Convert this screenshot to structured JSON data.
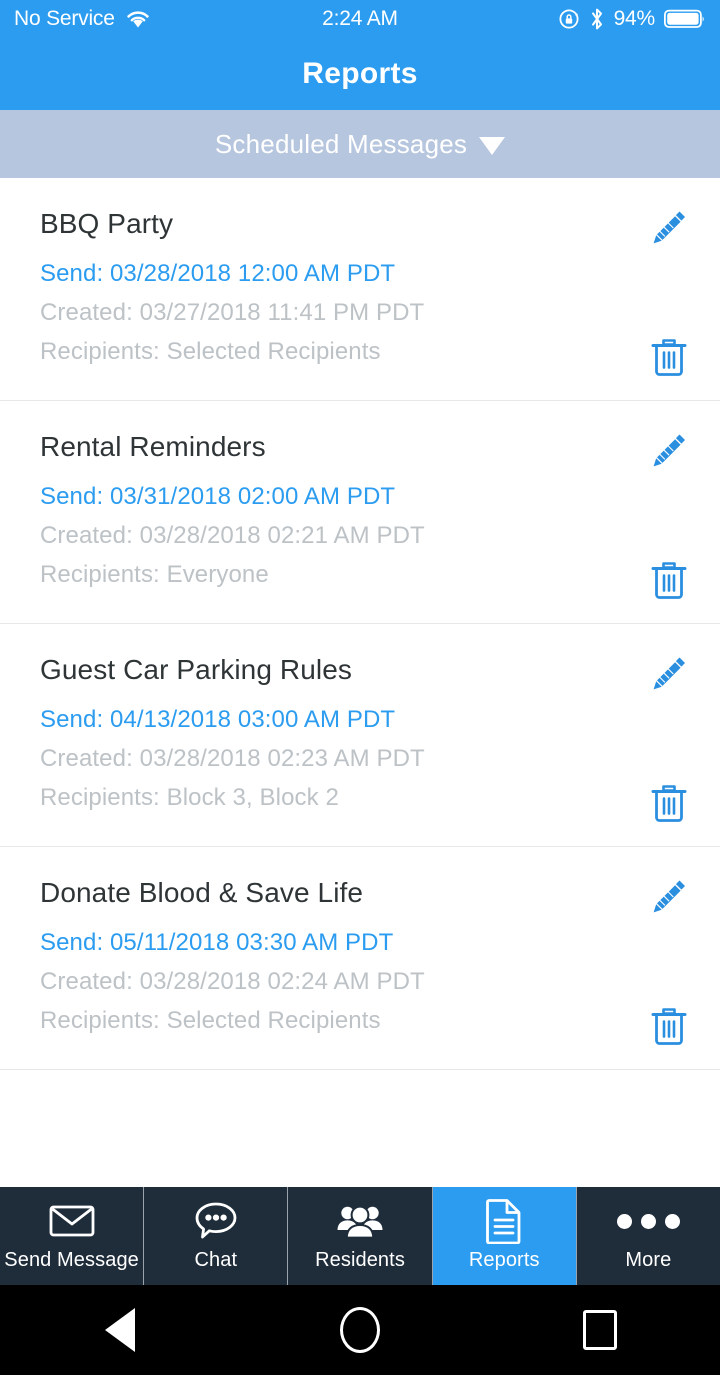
{
  "status_bar": {
    "carrier": "No Service",
    "wifi_icon": "wifi-icon",
    "time": "2:24 AM",
    "rotation_lock_icon": "rotation-lock-icon",
    "bluetooth_icon": "bluetooth-icon",
    "battery_percent": "94%",
    "battery_icon": "battery-icon"
  },
  "header": {
    "title": "Reports",
    "background_color": "#2b9cf0"
  },
  "filter": {
    "selected": "Scheduled Messages",
    "caret_icon": "chevron-down-icon",
    "background_color": "#b6c6de",
    "options": [
      "Scheduled Messages"
    ]
  },
  "list": {
    "labels": {
      "send_prefix": "Send:",
      "created_prefix": "Created:",
      "recipients_prefix": "Recipients:"
    },
    "items": [
      {
        "title": "BBQ Party",
        "send": "Send: 03/28/2018 12:00 AM PDT",
        "created": "Created: 03/27/2018 11:41 PM PDT",
        "recipients": "Recipients: Selected Recipients",
        "edit_icon": "pencil-icon",
        "delete_icon": "trash-icon"
      },
      {
        "title": "Rental Reminders",
        "send": "Send: 03/31/2018 02:00 AM PDT",
        "created": "Created: 03/28/2018 02:21 AM PDT",
        "recipients": "Recipients: Everyone",
        "edit_icon": "pencil-icon",
        "delete_icon": "trash-icon"
      },
      {
        "title": "Guest Car Parking Rules",
        "send": "Send: 04/13/2018 03:00 AM PDT",
        "created": "Created: 03/28/2018 02:23 AM PDT",
        "recipients": "Recipients: Block 3, Block 2",
        "edit_icon": "pencil-icon",
        "delete_icon": "trash-icon"
      },
      {
        "title": "Donate Blood & Save Life",
        "send": "Send: 05/11/2018 03:30 AM PDT",
        "created": "Created: 03/28/2018 02:24 AM PDT",
        "recipients": "Recipients: Selected Recipients",
        "edit_icon": "pencil-icon",
        "delete_icon": "trash-icon"
      }
    ]
  },
  "tab_bar": {
    "active_color": "#2b9cf0",
    "background_color": "#1f2d3b",
    "tabs": [
      {
        "label": "Send Message",
        "icon": "envelope-icon",
        "active": false
      },
      {
        "label": "Chat",
        "icon": "chat-bubble-icon",
        "active": false
      },
      {
        "label": "Residents",
        "icon": "people-group-icon",
        "active": false
      },
      {
        "label": "Reports",
        "icon": "document-icon",
        "active": true
      },
      {
        "label": "More",
        "icon": "ellipsis-icon",
        "active": false
      }
    ]
  },
  "nav_bar": {
    "back_icon": "back-triangle-icon",
    "home_icon": "home-circle-icon",
    "recents_icon": "recents-square-icon"
  },
  "colors": {
    "accent_blue": "#2b9cf0",
    "muted_text": "#bdc2c6",
    "title_text": "#2f3437",
    "divider": "#e6e8ea"
  }
}
